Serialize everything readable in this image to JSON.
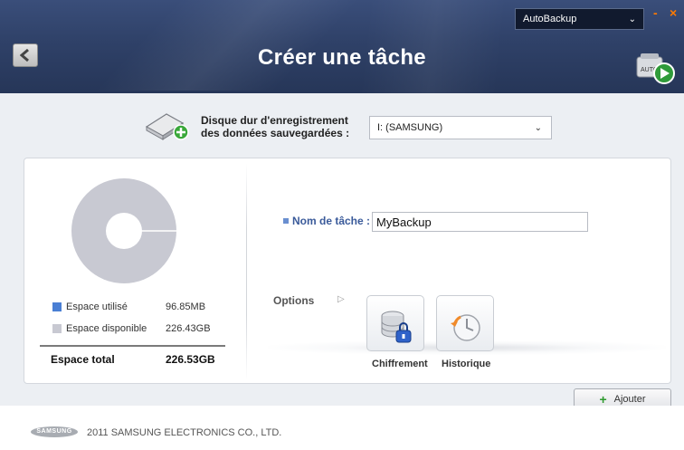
{
  "header": {
    "title": "Créer une tâche",
    "app_select_value": "AutoBackup",
    "minimize_label": "-",
    "close_label": "×"
  },
  "disk": {
    "label_line1": "Disque dur d'enregistrement",
    "label_line2": "des données sauvegardées :",
    "selected": "I: (SAMSUNG)"
  },
  "storage": {
    "used_label": "Espace utilisé",
    "used_value": "96.85MB",
    "available_label": "Espace disponible",
    "available_value": "226.43GB",
    "total_label": "Espace total",
    "total_value": "226.53GB",
    "used_fraction": 0.0004,
    "used_color": "#4a7fd4",
    "available_color": "#c8c9d2"
  },
  "task": {
    "name_label": "Nom de tâche :",
    "name_value": "MyBackup"
  },
  "options": {
    "label": "Options",
    "arrow": "▷",
    "items": [
      {
        "label": "Chiffrement",
        "icon": "database-lock-icon"
      },
      {
        "label": "Historique",
        "icon": "clock-history-icon"
      }
    ]
  },
  "actions": {
    "add_label": "Ajouter"
  },
  "footer": {
    "logo_text": "SAMSUNG",
    "copyright": "2011 SAMSUNG ELECTRONICS CO., LTD."
  }
}
